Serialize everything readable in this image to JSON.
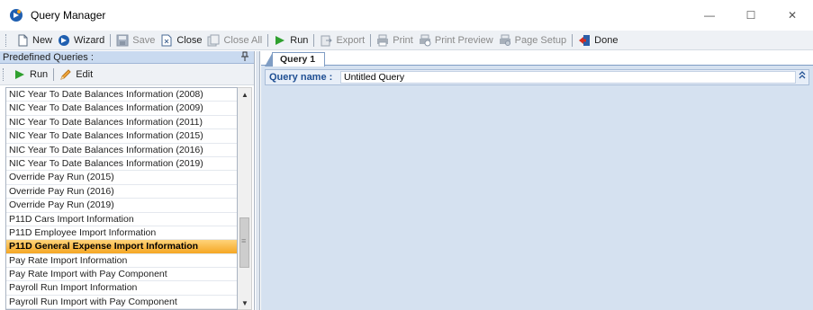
{
  "window": {
    "title": "Query Manager",
    "controls": {
      "minimize": "—",
      "maximize": "☐",
      "close": "✕"
    }
  },
  "toolbar": {
    "items": [
      {
        "label": "New",
        "icon": "new-document-icon",
        "enabled": true
      },
      {
        "label": "Wizard",
        "icon": "wizard-icon",
        "enabled": true
      },
      {
        "label": "Save",
        "icon": "save-icon",
        "enabled": false
      },
      {
        "label": "Close",
        "icon": "close-document-icon",
        "enabled": true
      },
      {
        "label": "Close All",
        "icon": "close-all-icon",
        "enabled": false
      },
      {
        "label": "Run",
        "icon": "run-icon",
        "enabled": true
      },
      {
        "label": "Export",
        "icon": "export-icon",
        "enabled": false
      },
      {
        "label": "Print",
        "icon": "print-icon",
        "enabled": false
      },
      {
        "label": "Print Preview",
        "icon": "print-preview-icon",
        "enabled": false
      },
      {
        "label": "Page Setup",
        "icon": "page-setup-icon",
        "enabled": false
      },
      {
        "label": "Done",
        "icon": "done-icon",
        "enabled": true
      }
    ]
  },
  "predefined": {
    "header": "Predefined Queries :",
    "pin_glyph": "ᵖ",
    "run_label": "Run",
    "edit_label": "Edit",
    "items": [
      "NIC Year To Date Balances Information (2008)",
      "NIC Year To Date Balances Information (2009)",
      "NIC Year To Date Balances Information (2011)",
      "NIC Year To Date Balances Information (2015)",
      "NIC Year To Date Balances Information (2016)",
      "NIC Year To Date Balances Information (2019)",
      "Override Pay Run (2015)",
      "Override Pay Run (2016)",
      "Override Pay Run (2019)",
      "P11D Cars Import Information",
      "P11D Employee Import Information",
      "P11D General Expense Import Information",
      "Pay Rate Import Information",
      "Pay Rate Import with Pay Component",
      "Payroll Run Import Information",
      "Payroll Run Import with Pay Component"
    ],
    "selected_item": "P11D General Expense Import Information"
  },
  "editor": {
    "tab_label": "Query 1",
    "query_name_label": "Query name :",
    "query_name_value": "Untitled Query",
    "colors": {
      "label_blue": "#1f4f93",
      "background": "#d5e1f0",
      "selection": "#f5a623"
    }
  }
}
